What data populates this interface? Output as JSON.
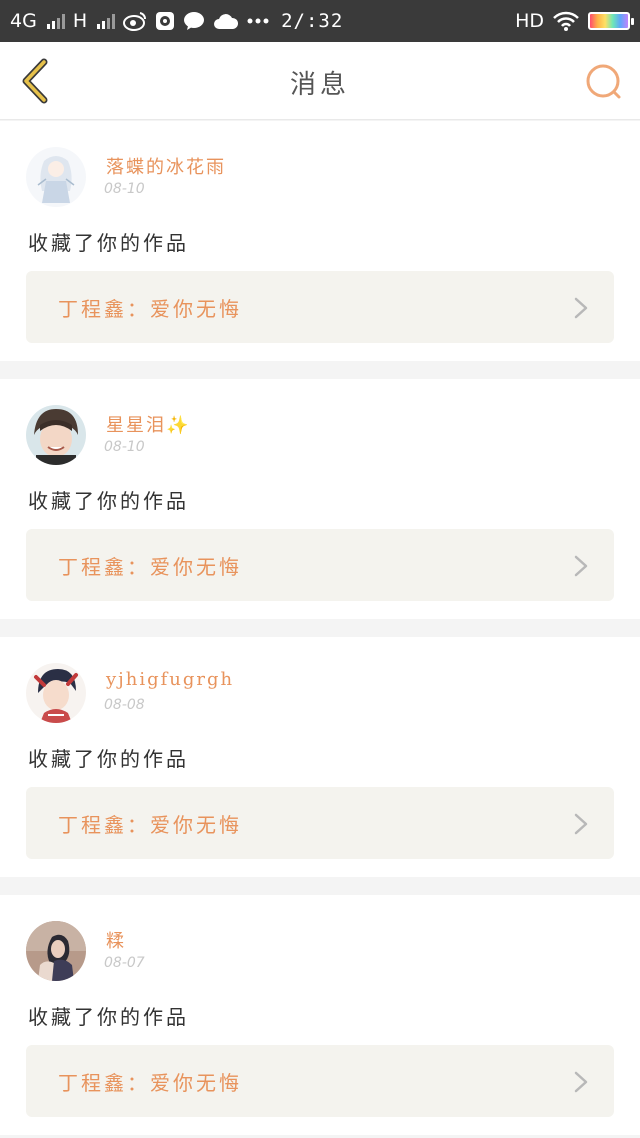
{
  "status_bar": {
    "network_label": "4G",
    "network2_label": "H",
    "time": "2/:32",
    "hd_label": "HD"
  },
  "nav": {
    "title": "消息",
    "back_icon": "chevron-left-icon",
    "search_icon": "search-icon"
  },
  "colors": {
    "accent": "#e8935c",
    "back": "#e6c14a",
    "card_bg": "#ffffff",
    "link_bg": "#f4f3ee"
  },
  "messages": [
    {
      "username": "落蝶的冰花雨",
      "date": "08-10",
      "action": "收藏了你的作品",
      "work_title": "丁程鑫：爱你无悔"
    },
    {
      "username": "星星泪✨",
      "date": "08-10",
      "action": "收藏了你的作品",
      "work_title": "丁程鑫：爱你无悔"
    },
    {
      "username": "yjhigfugrgh",
      "date": "08-08",
      "action": "收藏了你的作品",
      "work_title": "丁程鑫：爱你无悔"
    },
    {
      "username": "糅",
      "date": "08-07",
      "action": "收藏了你的作品",
      "work_title": "丁程鑫：爱你无悔"
    }
  ]
}
